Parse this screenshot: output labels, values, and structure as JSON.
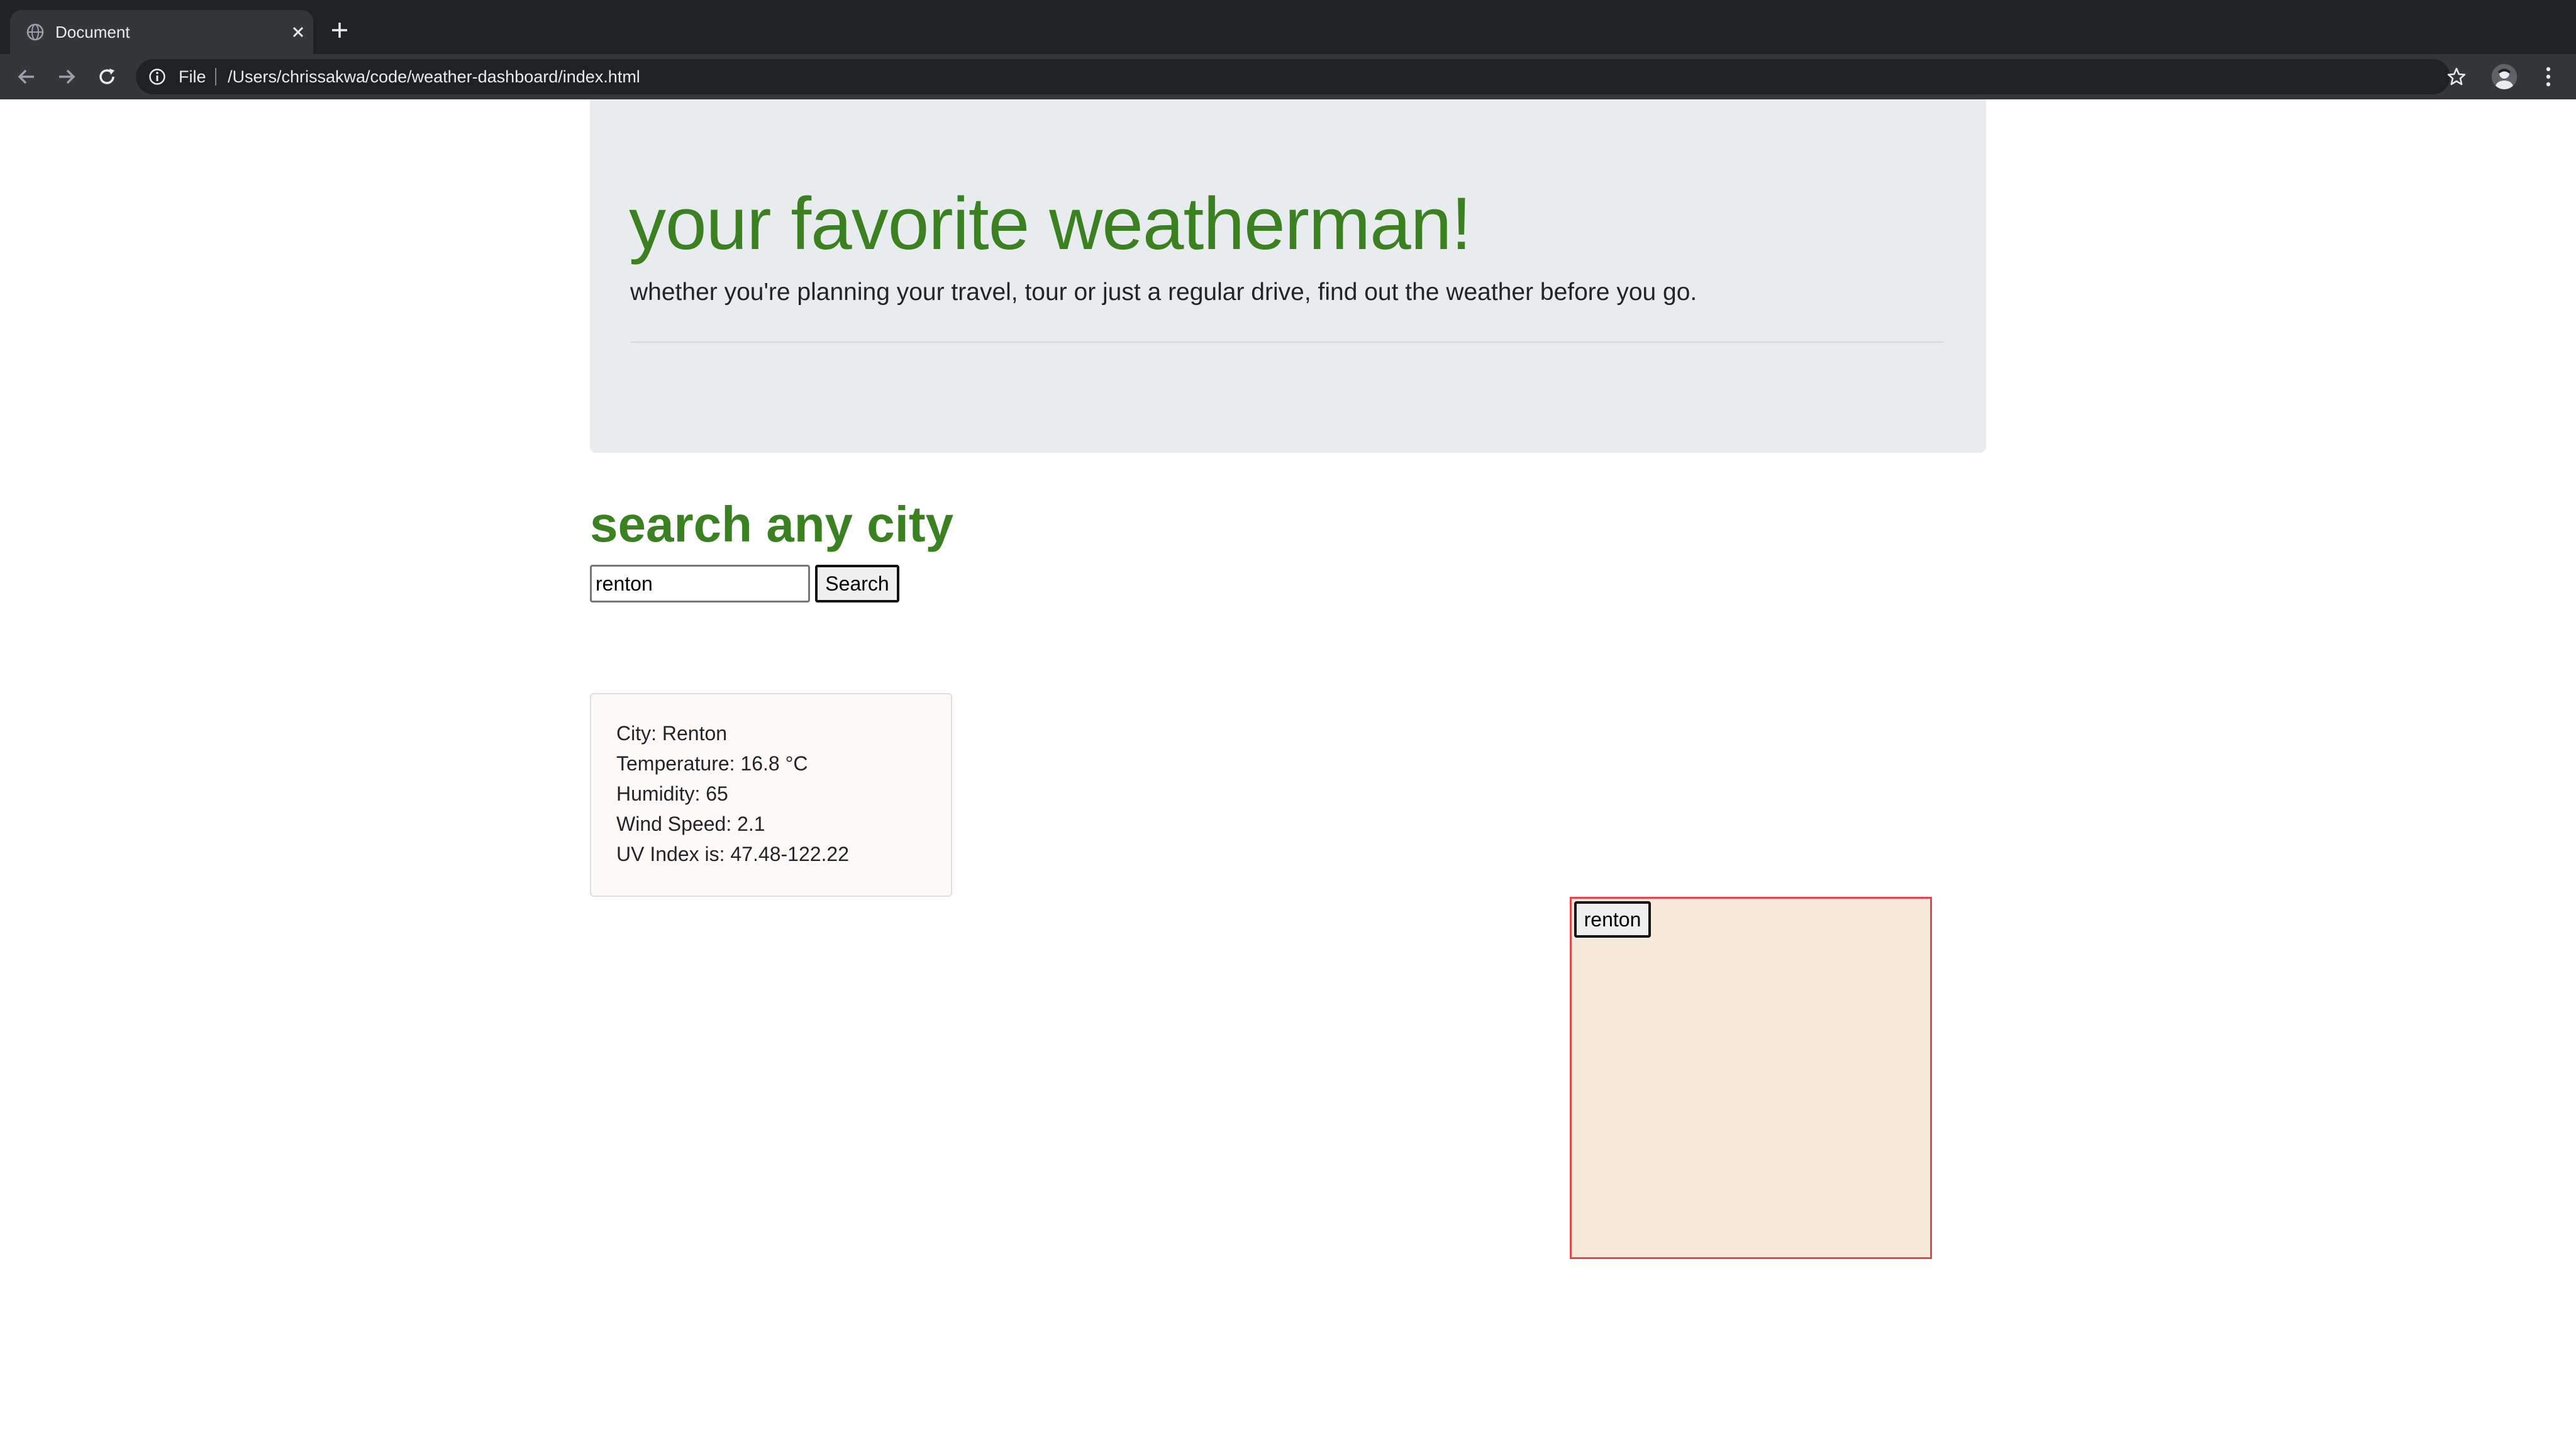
{
  "browser": {
    "tab_title": "Document",
    "url_scheme_label": "File",
    "url": "/Users/chrissakwa/code/weather-dashboard/index.html",
    "icons": [
      "globe-icon",
      "close-icon",
      "plus-icon",
      "back-arrow-icon",
      "forward-arrow-icon",
      "reload-icon",
      "info-icon",
      "star-icon",
      "avatar",
      "kebab-menu-icon"
    ]
  },
  "header": {
    "title": "your favorite weatherman!",
    "lead": "whether you're planning your travel, tour or just a regular drive, find out the weather before you go."
  },
  "search": {
    "heading": "search any city",
    "input_value": "renton",
    "button_label": "Search"
  },
  "weather": {
    "city": "City: Renton",
    "temperature": "Temperature: 16.8 °C",
    "humidity": "Humidity: 65",
    "wind_speed": "Wind Speed: 2.1",
    "uv_index": "UV Index is: 47.48-122.22"
  },
  "history": {
    "items": [
      {
        "label": "renton"
      }
    ]
  },
  "colors": {
    "accent_green": "#3b8122",
    "jumbotron_bg": "#e9ecef",
    "history_border": "#e0484d",
    "history_bg": "#f7eadb"
  }
}
